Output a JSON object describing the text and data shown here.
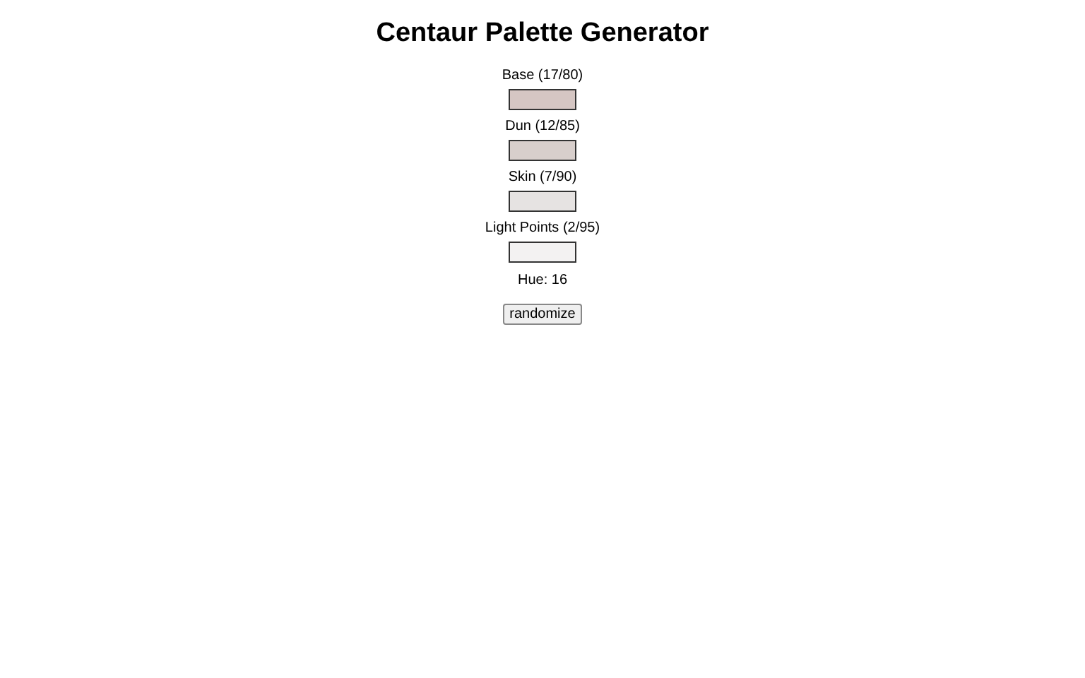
{
  "title": "Centaur Palette Generator",
  "swatches": [
    {
      "label": "Base (17/80)",
      "color": "#d5c6c3"
    },
    {
      "label": "Dun (12/85)",
      "color": "#d8cfcc"
    },
    {
      "label": "Skin (7/90)",
      "color": "#e6e3e2"
    },
    {
      "label": "Light Points (2/95)",
      "color": "#f3f2f2"
    }
  ],
  "hue": "Hue: 16",
  "button": "randomize"
}
